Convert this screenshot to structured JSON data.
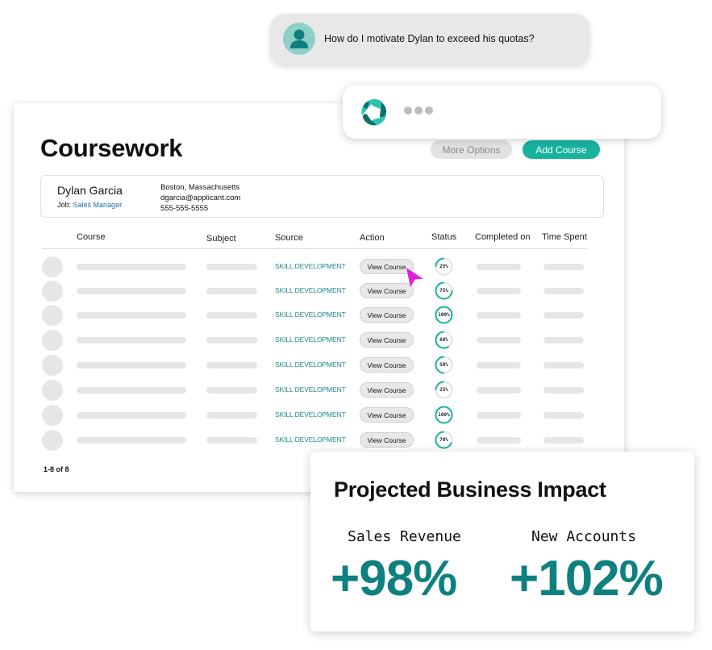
{
  "chat": {
    "user_question": "How do I motivate Dylan to exceed his quotas?",
    "user_avatar_icon": "person-icon",
    "bot_logo_icon": "triskelion-logo-icon",
    "bot_typing_indicator": "typing-dots"
  },
  "coursework": {
    "title": "Coursework",
    "buttons": {
      "more_options": "More Options",
      "add_course": "Add Course"
    },
    "profile": {
      "name": "Dylan Garcia",
      "job_label": "Job:",
      "job_value": "Sales Manager",
      "location": "Boston, Massachusetts",
      "email": "dgarcia@applicant.com",
      "phone": "555-555-5555"
    },
    "columns": [
      "Course",
      "Subject",
      "Source",
      "Action",
      "Status",
      "Completed on",
      "Time Spent"
    ],
    "rows": [
      {
        "source": "SKILL DEVELOPMENT",
        "action": "View Course",
        "status": "25%",
        "progress": 25
      },
      {
        "source": "SKILL DEVELOPMENT",
        "action": "View Course",
        "status": "75%",
        "progress": 75
      },
      {
        "source": "SKILL DEVELOPMENT",
        "action": "View Course",
        "status": "100%",
        "progress": 100
      },
      {
        "source": "SKILL DEVELOPMENT",
        "action": "View Course",
        "status": "60%",
        "progress": 60
      },
      {
        "source": "SKILL DEVELOPMENT",
        "action": "View Course",
        "status": "50%",
        "progress": 50
      },
      {
        "source": "SKILL DEVELOPMENT",
        "action": "View Course",
        "status": "25%",
        "progress": 25
      },
      {
        "source": "SKILL DEVELOPMENT",
        "action": "View Course",
        "status": "100%",
        "progress": 100
      },
      {
        "source": "SKILL DEVELOPMENT",
        "action": "View Course",
        "status": "70%",
        "progress": 70
      }
    ],
    "pagination": "1-8 of 8"
  },
  "impact": {
    "title": "Projected Business Impact",
    "metrics": [
      {
        "label": "Sales Revenue",
        "value": "+98%"
      },
      {
        "label": "New Accounts",
        "value": "+102%"
      }
    ]
  },
  "colors": {
    "accent": "#17b39f",
    "teal_dark": "#0e8080",
    "source_text": "#1a8a87",
    "cursor": "#e020e0",
    "ring_track": "#e3e3e3"
  }
}
